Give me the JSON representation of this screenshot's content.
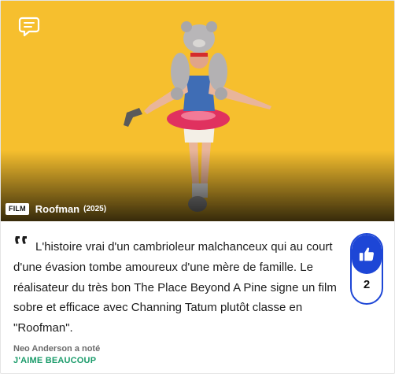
{
  "media": {
    "type_badge": "FILM",
    "title": "Roofman",
    "year": "(2025)"
  },
  "review": {
    "text": "L'histoire vrai d'un cambrioleur malchanceux qui au court d'une évasion tombe amoureux d'une mère de famille. Le réalisateur du très bon The Place Beyond A Pine signe un film sobre et efficace avec Channing Tatum plutôt classe en \"Roofman\".",
    "author": "Neo Anderson a noté",
    "rating": "J'AIME BEAUCOUP"
  },
  "likes": {
    "count": "2"
  },
  "icons": {
    "comment": "comment-bubble-icon",
    "quote": "quote-icon",
    "like": "thumbs-up-icon"
  },
  "colors": {
    "poster_background": "#f6bf2e",
    "like_accent": "#1d46d6",
    "rating_green": "#1a9b6a"
  }
}
